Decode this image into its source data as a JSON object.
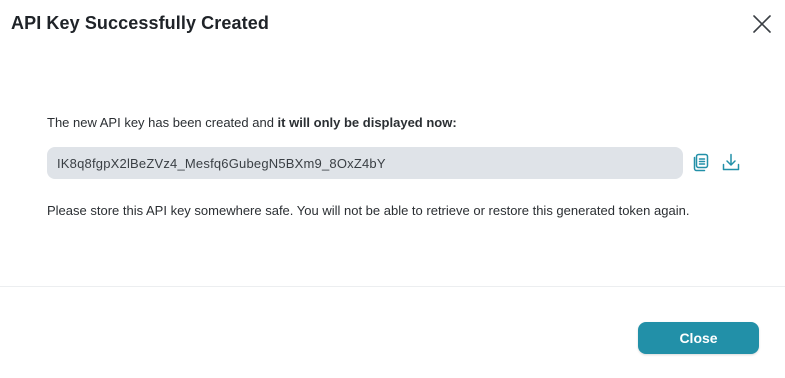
{
  "dialog": {
    "title": "API Key Successfully Created",
    "close_icon": "close-icon",
    "intro_prefix": "The new API key has been created and ",
    "intro_emphasis": "it will only be displayed now:",
    "api_key": "IK8q8fgpX2lBeZVz4_Mesfq6GubegN5BXm9_8OxZ4bY",
    "copy_icon": "copy-icon",
    "download_icon": "download-icon",
    "notice": "Please store this API key somewhere safe. You will not be able to retrieve or restore this generated token again.",
    "close_label": "Close"
  },
  "colors": {
    "primary": "#2290a8",
    "key_background": "#dfe3e8",
    "icon": "#2290a8"
  }
}
